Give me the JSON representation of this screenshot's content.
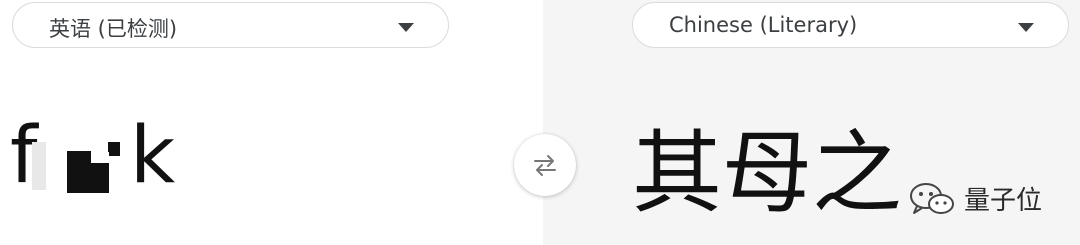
{
  "source": {
    "language_label": "英语 (已检测)",
    "text_first_letter": "f",
    "text_last_letter": "k"
  },
  "target": {
    "language_label": "Chinese (Literary)",
    "text": "其母之"
  },
  "swap": {
    "icon": "swap-arrows-icon"
  },
  "watermark": {
    "text": "量子位",
    "icon": "wechat-icon"
  },
  "colors": {
    "left_background": "#ffffff",
    "right_background": "#f5f5f5",
    "border": "#dadce0",
    "text": "#3c4043"
  }
}
